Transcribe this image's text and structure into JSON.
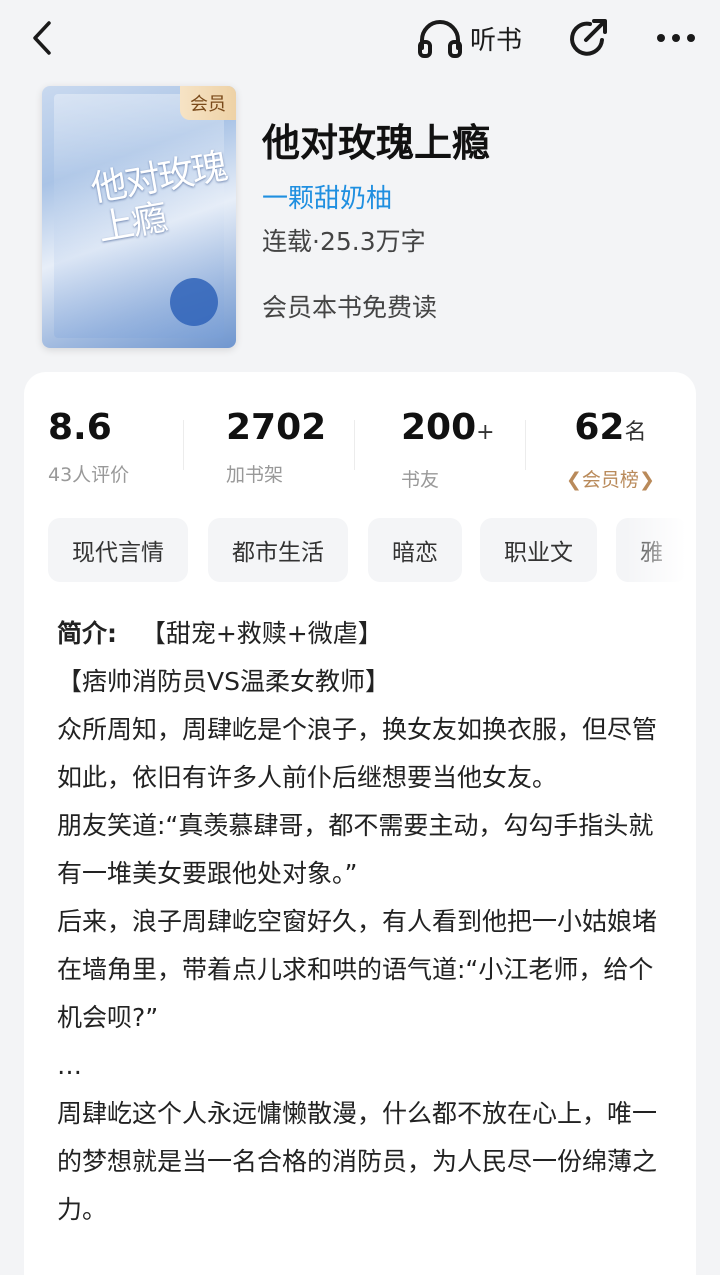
{
  "topbar": {
    "listen_label": "听书"
  },
  "book": {
    "title": "他对玫瑰上瘾",
    "author": "一颗甜奶柚",
    "status": "连载·25.3万字",
    "free_text": "会员本书免费读",
    "vip_badge": "会员",
    "cover_title": "他对玫瑰上瘾"
  },
  "stats": {
    "score": {
      "value": "8.6",
      "label": "43人评价"
    },
    "shelf": {
      "value": "2702",
      "label": "加书架"
    },
    "friends": {
      "value": "200",
      "suffix": "+",
      "label": "书友"
    },
    "rank": {
      "value": "62",
      "suffix": "名",
      "label": "会员榜"
    }
  },
  "tags": [
    "现代言情",
    "都市生活",
    "暗恋",
    "职业文",
    "雅"
  ],
  "intro": {
    "heading": "简介:",
    "lines": [
      "【甜宠+救赎+微虐】",
      "【痞帅消防员VS温柔女教师】",
      "众所周知，周肆屹是个浪子，换女友如换衣服，但尽管如此，依旧有许多人前仆后继想要当他女友。",
      "朋友笑道:“真羡慕肆哥，都不需要主动，勾勾手指头就有一堆美女要跟他处对象。”",
      "后来，浪子周肆屹空窗好久，有人看到他把一小姑娘堵在墙角里，带着点儿求和哄的语气道:“小江老师，给个机会呗?”",
      "…",
      "周肆屹这个人永远慵懒散漫，什么都不放在心上，唯一的梦想就是当一名合格的消防员，为人民尽一份绵薄之力。"
    ]
  },
  "colors": {
    "author": "#1f8fe0",
    "rank_label": "#b98a5a",
    "vip_badge_bg": "#f6e3c5"
  }
}
